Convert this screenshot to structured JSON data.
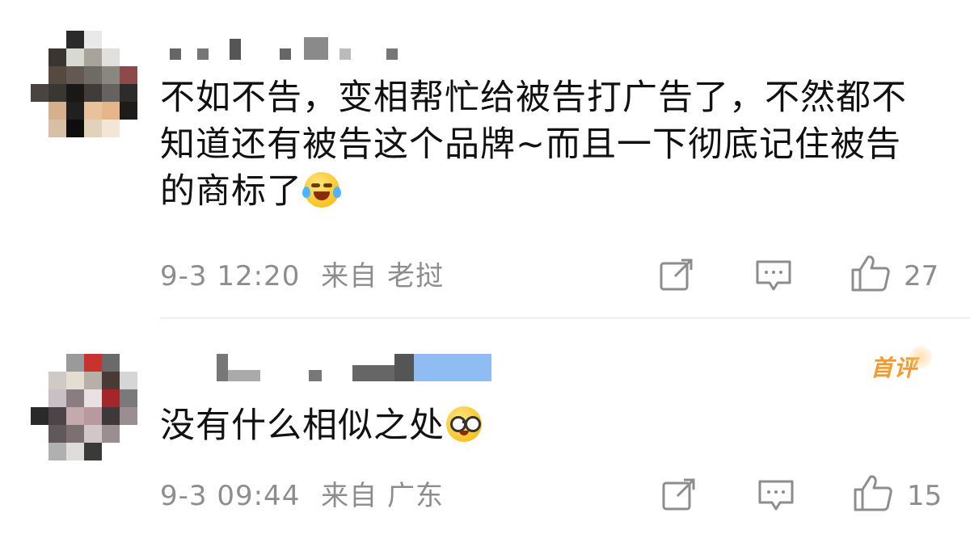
{
  "comments": [
    {
      "text_line1": "不如不告，变相帮忙给被告打广告了，不然都不",
      "text_line2": "知道还有被告这个品牌~而且一下彻底记住被告",
      "text_line3": "的商标了",
      "emoji": "laugh-cry-emoji",
      "date": "9-3 12:20",
      "source_label": "来自 老挝",
      "like_count": "27",
      "actions": [
        "share-icon",
        "comment-icon",
        "like-icon"
      ]
    },
    {
      "badge": "首评",
      "text": "没有什么相似之处",
      "emoji": "glasses-emoji",
      "date": "9-3 09:44",
      "source_label": "来自 广东",
      "like_count": "15",
      "actions": [
        "share-icon",
        "comment-icon",
        "like-icon"
      ]
    }
  ],
  "colors": {
    "meta_text": "#8d8d8d",
    "badge": "#f39a2b",
    "divider": "#e6e6e6"
  }
}
